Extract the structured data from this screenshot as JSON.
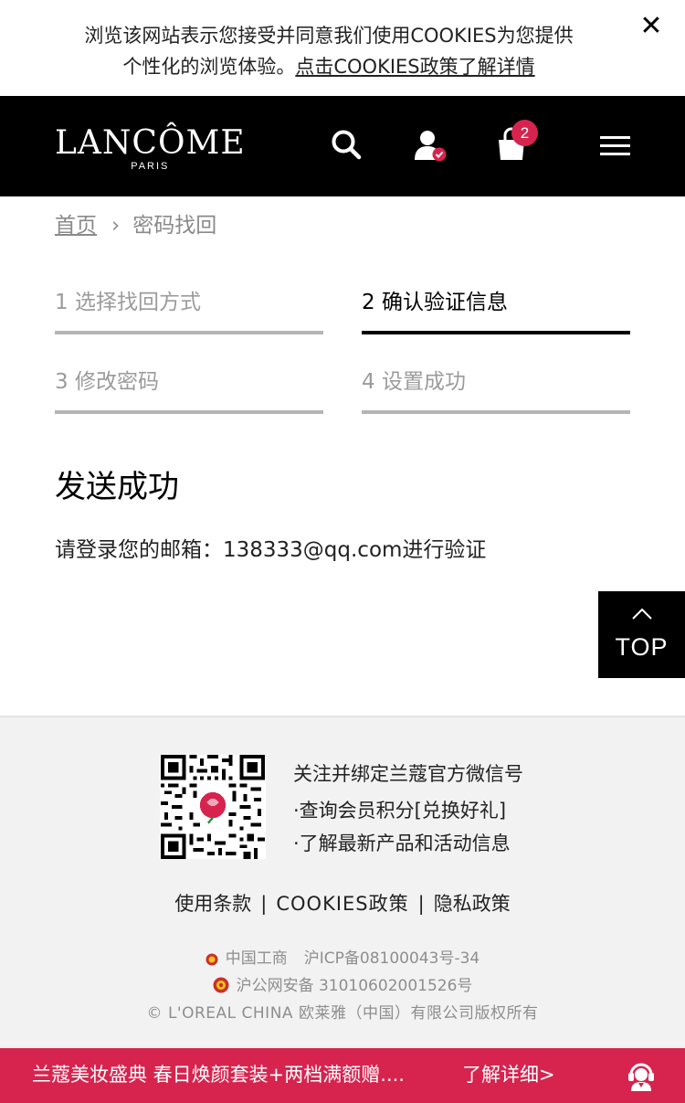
{
  "cookie_banner": {
    "text_line1": "浏览该网站表示您接受并同意我们使用COOKIES为您提供",
    "text_line2_plain": "个性化的浏览体验。",
    "text_line2_link": "点击COOKIES政策了解详情",
    "close_icon": "close-icon"
  },
  "header": {
    "logo_text": "LANCÔME",
    "logo_sub": "PARIS",
    "cart_count": "2",
    "icons": [
      "search-icon",
      "account-icon",
      "shopping-bag-icon",
      "menu-icon"
    ]
  },
  "breadcrumb": {
    "home": "首页",
    "separator": "›",
    "current": "密码找回"
  },
  "steps": [
    {
      "label": "1 选择找回方式",
      "active": false
    },
    {
      "label": "2 确认验证信息",
      "active": true
    },
    {
      "label": "3 修改密码",
      "active": false
    },
    {
      "label": "4 设置成功",
      "active": false
    }
  ],
  "result": {
    "title": "发送成功",
    "message": "请登录您的邮箱：138333@qq.com进行验证"
  },
  "top_button": {
    "label": "TOP"
  },
  "footer": {
    "wechat_title": "关注并绑定兰蔻官方微信号",
    "wechat_line1": "·查询会员积分[兑换好礼]",
    "wechat_line2": "·了解最新产品和活动信息",
    "links": [
      "使用条款",
      "COOKIES政策",
      "隐私政策"
    ],
    "link_separator": "|",
    "license_aic": "中国工商",
    "license_icp": "沪ICP备08100043号-34",
    "license_police": "沪公网安备 31010602001526号",
    "copyright": "© L'OREAL CHINA 欧莱雅（中国）有限公司版权所有"
  },
  "promo_bar": {
    "text": "兰蔻美妆盛典 春日焕颜套装+两档满额赠....",
    "more": "了解详细>",
    "icon": "customer-service-icon"
  },
  "colors": {
    "header_bg": "#000000",
    "accent": "#d6244f",
    "footer_bg": "#f2f2f2",
    "muted_text": "#8e8e8e"
  }
}
